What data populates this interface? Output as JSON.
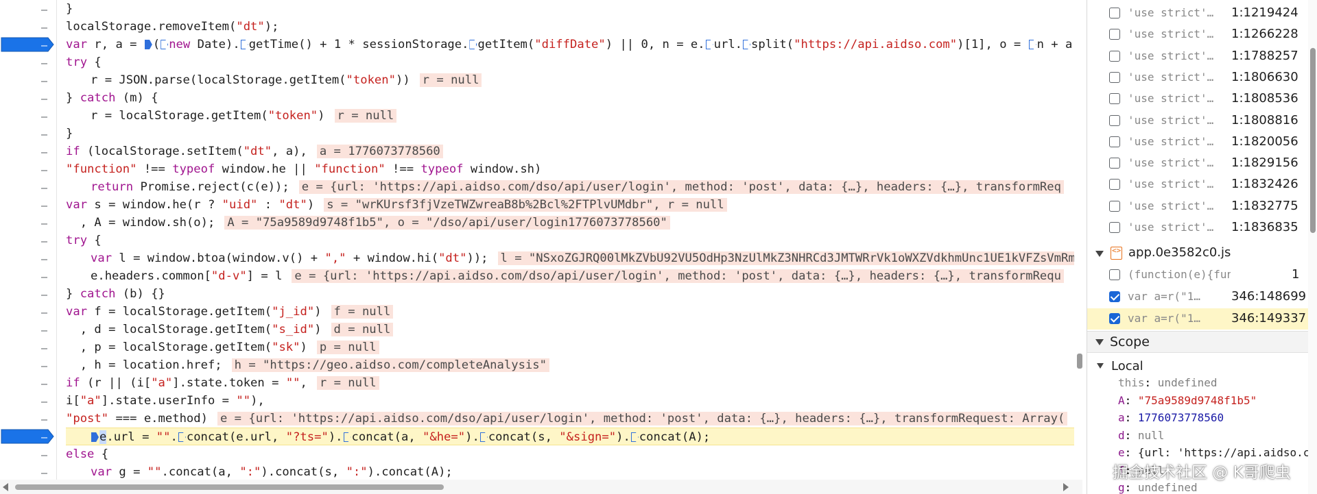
{
  "editor": {
    "gutter_dash": "–",
    "lines": [
      {
        "id": "l0",
        "indent": 0,
        "parts": [
          {
            "t": "}"
          }
        ]
      },
      {
        "id": "l1",
        "indent": 0,
        "parts": [
          {
            "t": "localStorage.removeItem("
          },
          {
            "t": "\"dt\"",
            "c": "str"
          },
          {
            "t": ");"
          }
        ]
      },
      {
        "id": "l2",
        "indent": 0,
        "bp": true,
        "parts": [
          {
            "t": "var",
            "c": "kw"
          },
          {
            "t": " r, a = "
          },
          {
            "m": "solid"
          },
          {
            "t": "("
          },
          {
            "m": "hollow"
          },
          {
            "t": "new",
            "c": "kw"
          },
          {
            "t": " Date)."
          },
          {
            "m": "hollow"
          },
          {
            "t": "getTime() + 1 * sessionStorage."
          },
          {
            "m": "hollow"
          },
          {
            "t": "getItem("
          },
          {
            "t": "\"diffDate\"",
            "c": "str"
          },
          {
            "t": ") || 0, n = e."
          },
          {
            "m": "hollow"
          },
          {
            "t": "url."
          },
          {
            "m": "hollow"
          },
          {
            "t": "split("
          },
          {
            "t": "\"https://api.aidso.com\"",
            "c": "str"
          },
          {
            "t": ")[1], o = "
          },
          {
            "m": "hollow"
          },
          {
            "t": "n + a"
          }
        ]
      },
      {
        "id": "l3",
        "indent": 0,
        "parts": [
          {
            "t": "try",
            "c": "kw"
          },
          {
            "t": " {"
          }
        ]
      },
      {
        "id": "l4",
        "indent": 1,
        "parts": [
          {
            "t": "r = JSON.parse(localStorage.getItem("
          },
          {
            "t": "\"token\"",
            "c": "str"
          },
          {
            "t": "))"
          }
        ],
        "inline": "r = null"
      },
      {
        "id": "l5",
        "indent": 0,
        "parts": [
          {
            "t": "} "
          },
          {
            "t": "catch",
            "c": "kw"
          },
          {
            "t": " (m) {"
          }
        ]
      },
      {
        "id": "l6",
        "indent": 1,
        "parts": [
          {
            "t": "r = localStorage.getItem("
          },
          {
            "t": "\"token\"",
            "c": "str"
          },
          {
            "t": ")"
          }
        ],
        "inline": "r = null"
      },
      {
        "id": "l7",
        "indent": 0,
        "parts": [
          {
            "t": "}"
          }
        ]
      },
      {
        "id": "l8",
        "indent": 0,
        "parts": [
          {
            "t": "if",
            "c": "kw"
          },
          {
            "t": " (localStorage.setItem("
          },
          {
            "t": "\"dt\"",
            "c": "str"
          },
          {
            "t": ", a),"
          }
        ],
        "inline": "a = 1776073778560"
      },
      {
        "id": "l9",
        "indent": 0,
        "parts": [
          {
            "t": "\"function\"",
            "c": "str"
          },
          {
            "t": " !== "
          },
          {
            "t": "typeof",
            "c": "kw"
          },
          {
            "t": " window.he || "
          },
          {
            "t": "\"function\"",
            "c": "str"
          },
          {
            "t": " !== "
          },
          {
            "t": "typeof",
            "c": "kw"
          },
          {
            "t": " window.sh)"
          }
        ]
      },
      {
        "id": "l10",
        "indent": 1,
        "parts": [
          {
            "t": "return",
            "c": "kw"
          },
          {
            "t": " Promise.reject(c(e));"
          }
        ],
        "inline": "e = {url: 'https://api.aidso.com/dso/api/user/login', method: 'post', data: {…}, headers: {…}, transformReq"
      },
      {
        "id": "l11",
        "indent": 0,
        "parts": [
          {
            "t": "var",
            "c": "kw"
          },
          {
            "t": " s = window.he(r ? "
          },
          {
            "t": "\"uid\"",
            "c": "str"
          },
          {
            "t": " : "
          },
          {
            "t": "\"dt\"",
            "c": "str"
          },
          {
            "t": ")"
          }
        ],
        "inline": "s = \"wrKUrsf3fjVzeTWZwreaB8b%2Bcl%2FTPlvUMdbr\", r = null"
      },
      {
        "id": "l12",
        "indent": 0,
        "parts": [
          {
            "t": "  , A = window.sh(o);"
          }
        ],
        "inline": "A = \"75a9589d9748f1b5\", o = \"/dso/api/user/login1776073778560\""
      },
      {
        "id": "l13",
        "indent": 0,
        "parts": [
          {
            "t": "try",
            "c": "kw"
          },
          {
            "t": " {"
          }
        ]
      },
      {
        "id": "l14",
        "indent": 1,
        "parts": [
          {
            "t": "var",
            "c": "kw"
          },
          {
            "t": " l = window.btoa(window.v() + "
          },
          {
            "t": "\",\"",
            "c": "str"
          },
          {
            "t": " + window.hi("
          },
          {
            "t": "\"dt\"",
            "c": "str"
          },
          {
            "t": "));"
          }
        ],
        "inline": "l = \"NSxoZGJRQ00lMkZVbU92VU5OdHp3NzUlMkZ3NHRCd3JMTWRrVk1oWXZVdkhmUnc1UE1kVFZsVmRm"
      },
      {
        "id": "l15",
        "indent": 1,
        "parts": [
          {
            "t": "e.headers.common["
          },
          {
            "t": "\"d-v\"",
            "c": "str"
          },
          {
            "t": "] = l"
          }
        ],
        "inline": "e = {url: 'https://api.aidso.com/dso/api/user/login', method: 'post', data: {…}, headers: {…}, transformRequ"
      },
      {
        "id": "l16",
        "indent": 0,
        "parts": [
          {
            "t": "} "
          },
          {
            "t": "catch",
            "c": "kw"
          },
          {
            "t": " (b) {}"
          }
        ]
      },
      {
        "id": "l17",
        "indent": 0,
        "parts": [
          {
            "t": "var",
            "c": "kw"
          },
          {
            "t": " f = localStorage.getItem("
          },
          {
            "t": "\"j_id\"",
            "c": "str"
          },
          {
            "t": ")"
          }
        ],
        "inline": "f = null"
      },
      {
        "id": "l18",
        "indent": 0,
        "parts": [
          {
            "t": "  , d = localStorage.getItem("
          },
          {
            "t": "\"s_id\"",
            "c": "str"
          },
          {
            "t": ")"
          }
        ],
        "inline": "d = null"
      },
      {
        "id": "l19",
        "indent": 0,
        "parts": [
          {
            "t": "  , p = localStorage.getItem("
          },
          {
            "t": "\"sk\"",
            "c": "str"
          },
          {
            "t": ")"
          }
        ],
        "inline": "p = null"
      },
      {
        "id": "l20",
        "indent": 0,
        "parts": [
          {
            "t": "  , h = location.href;"
          }
        ],
        "inline": "h = \"https://geo.aidso.com/completeAnalysis\""
      },
      {
        "id": "l21",
        "indent": 0,
        "parts": [
          {
            "t": "if",
            "c": "kw"
          },
          {
            "t": " (r || (i["
          },
          {
            "t": "\"a\"",
            "c": "str"
          },
          {
            "t": "].state.token = "
          },
          {
            "t": "\"\"",
            "c": "str"
          },
          {
            "t": ","
          }
        ],
        "inline": "r = null"
      },
      {
        "id": "l22",
        "indent": 0,
        "parts": [
          {
            "t": "i["
          },
          {
            "t": "\"a\"",
            "c": "str"
          },
          {
            "t": "].state.userInfo = "
          },
          {
            "t": "\"\"",
            "c": "str"
          },
          {
            "t": "),"
          }
        ]
      },
      {
        "id": "l23",
        "indent": 0,
        "parts": [
          {
            "t": "\"post\"",
            "c": "str"
          },
          {
            "t": " === e.method)"
          }
        ],
        "inline": "e = {url: 'https://api.aidso.com/dso/api/user/login', method: 'post', data: {…}, headers: {…}, transformRequest: Array("
      },
      {
        "id": "l24",
        "indent": 1,
        "bp": true,
        "exec": true,
        "parts": [
          {
            "m": "solid"
          },
          {
            "t": "e",
            "c": "caret"
          },
          {
            "t": ".url = "
          },
          {
            "t": "\"\"",
            "c": "str"
          },
          {
            "t": "."
          },
          {
            "m": "hollow"
          },
          {
            "t": "concat(e.url, "
          },
          {
            "t": "\"?ts=\"",
            "c": "str"
          },
          {
            "t": ")."
          },
          {
            "m": "hollow"
          },
          {
            "t": "concat(a, "
          },
          {
            "t": "\"&he=\"",
            "c": "str"
          },
          {
            "t": ")."
          },
          {
            "m": "hollow"
          },
          {
            "t": "concat(s, "
          },
          {
            "t": "\"&sign=\"",
            "c": "str"
          },
          {
            "t": ")."
          },
          {
            "m": "hollow"
          },
          {
            "t": "concat(A);"
          }
        ]
      },
      {
        "id": "l25",
        "indent": 0,
        "parts": [
          {
            "t": "else",
            "c": "kw"
          },
          {
            "t": " {"
          }
        ]
      },
      {
        "id": "l26",
        "indent": 1,
        "parts": [
          {
            "t": "var",
            "c": "kw"
          },
          {
            "t": " g = "
          },
          {
            "t": "\"\"",
            "c": "str"
          },
          {
            "t": ".concat(a, "
          },
          {
            "t": "\":\"",
            "c": "str"
          },
          {
            "t": ").concat(s, "
          },
          {
            "t": "\":\"",
            "c": "str"
          },
          {
            "t": ").concat(A);"
          }
        ]
      }
    ]
  },
  "breakpoints": {
    "rows": [
      {
        "snippet": "'use strict'…",
        "location": "1:1219424",
        "checked": false
      },
      {
        "snippet": "'use strict'…",
        "location": "1:1266228",
        "checked": false
      },
      {
        "snippet": "'use strict'…",
        "location": "1:1788257",
        "checked": false
      },
      {
        "snippet": "'use strict'…",
        "location": "1:1806630",
        "checked": false
      },
      {
        "snippet": "'use strict'…",
        "location": "1:1808536",
        "checked": false
      },
      {
        "snippet": "'use strict'…",
        "location": "1:1808816",
        "checked": false
      },
      {
        "snippet": "'use strict'…",
        "location": "1:1820056",
        "checked": false
      },
      {
        "snippet": "'use strict'…",
        "location": "1:1829156",
        "checked": false
      },
      {
        "snippet": "'use strict'…",
        "location": "1:1832426",
        "checked": false
      },
      {
        "snippet": "'use strict'…",
        "location": "1:1832775",
        "checked": false
      },
      {
        "snippet": "'use strict'…",
        "location": "1:1836835",
        "checked": false
      }
    ],
    "file_name": "app.0e3582c0.js",
    "file_icon": "<>",
    "file_rows": [
      {
        "snippet": "(function(e){functi…",
        "location": "1",
        "checked": false,
        "highlight": false
      },
      {
        "snippet": "var a=r(\"1…",
        "location": "346:148699",
        "checked": true,
        "highlight": false
      },
      {
        "snippet": "var a=r(\"1…",
        "location": "346:149337",
        "checked": true,
        "highlight": true
      }
    ]
  },
  "scope": {
    "title": "Scope",
    "local_title": "Local",
    "vars": [
      {
        "key": "this",
        "sep": ": ",
        "value": "undefined",
        "kind": "null",
        "dim": true
      },
      {
        "key": "A",
        "sep": ": ",
        "value": "\"75a9589d9748f1b5\"",
        "kind": "str"
      },
      {
        "key": "a",
        "sep": ": ",
        "value": "1776073778560",
        "kind": "num"
      },
      {
        "key": "d",
        "sep": ": ",
        "value": "null",
        "kind": "null"
      },
      {
        "key": "e",
        "sep": ": ",
        "value": "{url: 'https://api.aidso.c",
        "kind": "obj",
        "expand": true
      },
      {
        "key": "f",
        "sep": ": ",
        "value": "null",
        "kind": "null"
      },
      {
        "key": "g",
        "sep": ": ",
        "value": "undefined",
        "kind": "null"
      }
    ]
  },
  "watermark": "掘金技术社区 @ K哥爬虫",
  "colors": {
    "breakpoint": "#1a73e8",
    "exec_line": "#fef6c7",
    "inline_value_bg": "#fbe3dc",
    "keyword": "#a0158f",
    "string": "#c5221f"
  }
}
